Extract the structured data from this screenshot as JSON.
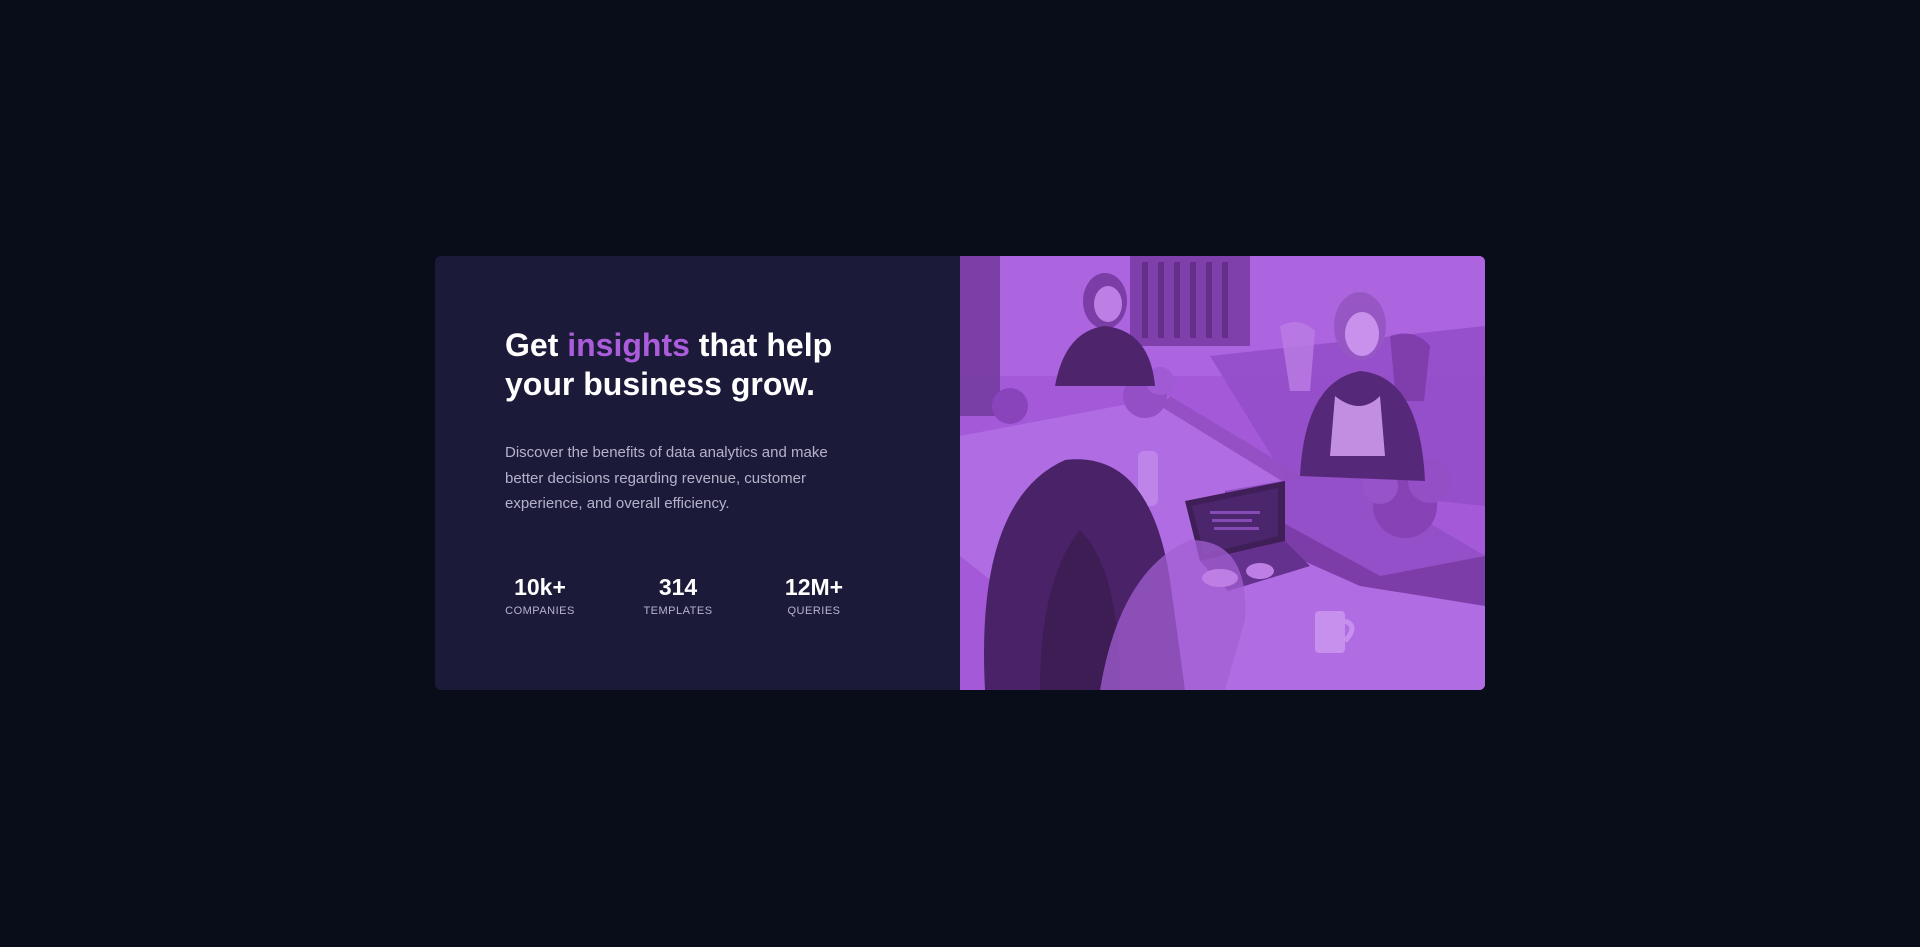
{
  "hero": {
    "headline_before": "Get ",
    "headline_accent": "insights",
    "headline_after": " that help your business grow.",
    "description": "Discover the benefits of data analytics and make better decisions regarding revenue, customer experience, and overall efficiency."
  },
  "stats": [
    {
      "value": "10k+",
      "label": "Companies"
    },
    {
      "value": "314",
      "label": "Templates"
    },
    {
      "value": "12M+",
      "label": "Queries"
    }
  ],
  "colors": {
    "page_background": "#090d1a",
    "card_background": "#1c1a39",
    "accent": "#ab5cdb",
    "image_overlay": "#a05dd6"
  },
  "image": {
    "subject": "people working at office table with laptop (purple overlay)"
  }
}
